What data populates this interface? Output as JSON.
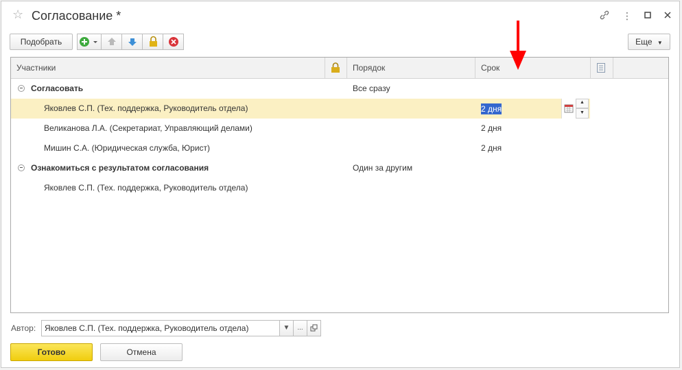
{
  "window": {
    "title": "Согласование *"
  },
  "toolbar": {
    "pick_label": "Подобрать",
    "more_label": "Еще"
  },
  "grid": {
    "headers": {
      "participants": "Участники",
      "order": "Порядок",
      "term": "Срок"
    },
    "groups": [
      {
        "label": "Согласовать",
        "order": "Все сразу",
        "rows": [
          {
            "participant": "Яковлев С.П. (Тех. поддержка, Руководитель отдела)",
            "term": "2 дня",
            "selected": true
          },
          {
            "participant": "Великанова Л.А. (Секретариат, Управляющий делами)",
            "term": "2 дня"
          },
          {
            "participant": "Мишин С.А. (Юридическая служба, Юрист)",
            "term": "2 дня"
          }
        ]
      },
      {
        "label": "Ознакомиться с результатом согласования",
        "order": "Один за другим",
        "rows": [
          {
            "participant": "Яковлев С.П. (Тех. поддержка, Руководитель отдела)",
            "term": ""
          }
        ]
      }
    ]
  },
  "footer": {
    "author_label": "Автор:",
    "author_value": "Яковлев С.П. (Тех. поддержка, Руководитель отдела)",
    "ellipsis": "...",
    "ok_label": "Готово",
    "cancel_label": "Отмена"
  },
  "colors": {
    "accent_yellow": "#f5d81d",
    "selection": "#fbf0c3",
    "arrow": "#ff0000"
  }
}
